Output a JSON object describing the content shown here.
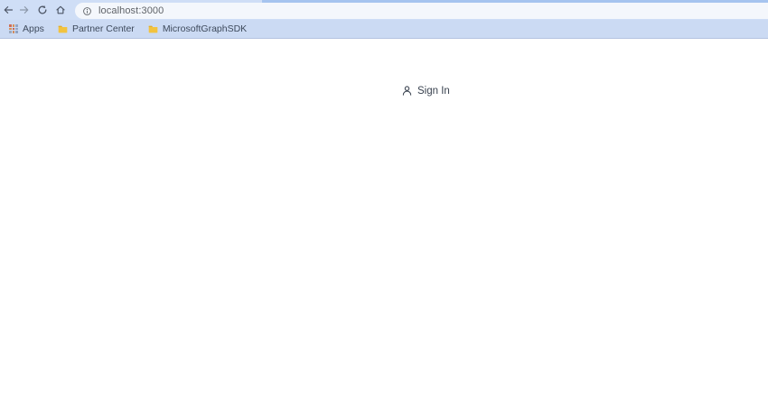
{
  "colors": {
    "toolbar-bg": "#cfdef6",
    "tabstrip-bg": "#a6c4ef",
    "omnibox-bg": "#f4f7fc",
    "bookmarks-bg": "#cbdaf3",
    "bookmarks-border": "#b3c2e0",
    "icon-gray": "#4d5666",
    "icon-disabled": "#8b97a8",
    "url-text": "#5f6368",
    "bookmark-text": "#3e4a5c",
    "folder-yellow": "#f2c33f",
    "signin-text": "#3a4350",
    "page-bg": "#ffffff"
  },
  "browser": {
    "toolbar": {
      "back_icon": "back-arrow",
      "forward_icon": "forward-arrow",
      "reload_icon": "reload",
      "home_icon": "home",
      "omnibox": {
        "icon": "info",
        "url": "localhost:3000"
      }
    },
    "bookmarks_bar": {
      "apps": {
        "icon": "apps-grid",
        "label": "Apps"
      },
      "folders": [
        {
          "icon": "folder",
          "label": "Partner Center"
        },
        {
          "icon": "folder",
          "label": "MicrosoftGraphSDK"
        }
      ]
    }
  },
  "page": {
    "signin": {
      "icon": "person",
      "label": "Sign In"
    }
  }
}
